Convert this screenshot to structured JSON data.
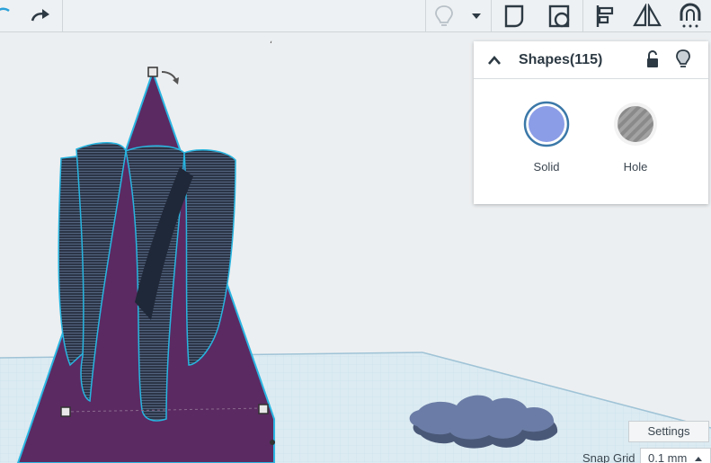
{
  "toolbar": {
    "items": [
      "undo-icon",
      "redo-icon",
      "lightbulb-icon",
      "dropdown-arrow-icon",
      "group-icon",
      "ungroup-icon",
      "align-icon",
      "mirror-icon",
      "magnet-icon"
    ]
  },
  "shapes_panel": {
    "title": "Shapes(115)",
    "solid_label": "Solid",
    "hole_label": "Hole",
    "solid_color": "#8b9de6",
    "hole_color": "#a9a9a9"
  },
  "workplane": {
    "settings_label": "Settings",
    "snap_grid_label": "Snap Grid",
    "snap_grid_value": "0.1 mm"
  },
  "colors": {
    "shape_purple": "#5c2a61",
    "screw_dark": "#2e3a4f",
    "selection_cyan": "#27b5e0",
    "gear_blue": "#55648a",
    "grid_light": "#cfe4ef"
  }
}
